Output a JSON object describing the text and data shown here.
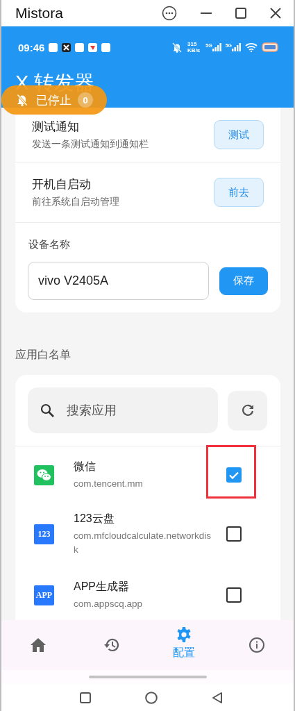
{
  "window": {
    "title": "Mistora"
  },
  "status_bar": {
    "time": "09:46",
    "speed_value": "315",
    "speed_unit": "KB/s",
    "networks": [
      "5G",
      "5G"
    ]
  },
  "app_bar": {
    "title": "X 转发器"
  },
  "status_pill": {
    "label": "已停止",
    "count": "0"
  },
  "settings": [
    {
      "kind": "action",
      "title": "测试通知",
      "subtitle": "发送一条测试通知到通知栏",
      "button": "测试"
    },
    {
      "kind": "action",
      "title": "开机自启动",
      "subtitle": "前往系统自启动管理",
      "button": "前去"
    },
    {
      "kind": "field",
      "title": "设备名称",
      "value": "vivo V2405A",
      "button": "保存"
    }
  ],
  "whitelist": {
    "heading": "应用白名单",
    "search": {
      "placeholder": "搜索应用"
    },
    "apps": [
      {
        "name": "微信",
        "package": "com.tencent.mm",
        "checked": true,
        "highlighted": true
      },
      {
        "badge": "123",
        "name": "123云盘",
        "package": "com.mfcloudcalculate.networkdisk",
        "checked": false,
        "highlighted": false
      },
      {
        "badge": "APP",
        "name": "APP生成器",
        "package": "com.appscq.app",
        "checked": false,
        "highlighted": false
      }
    ]
  },
  "bottom_nav": [
    {
      "selected": false
    },
    {
      "selected": false
    },
    {
      "label": "配置",
      "selected": true
    },
    {
      "selected": false
    }
  ]
}
